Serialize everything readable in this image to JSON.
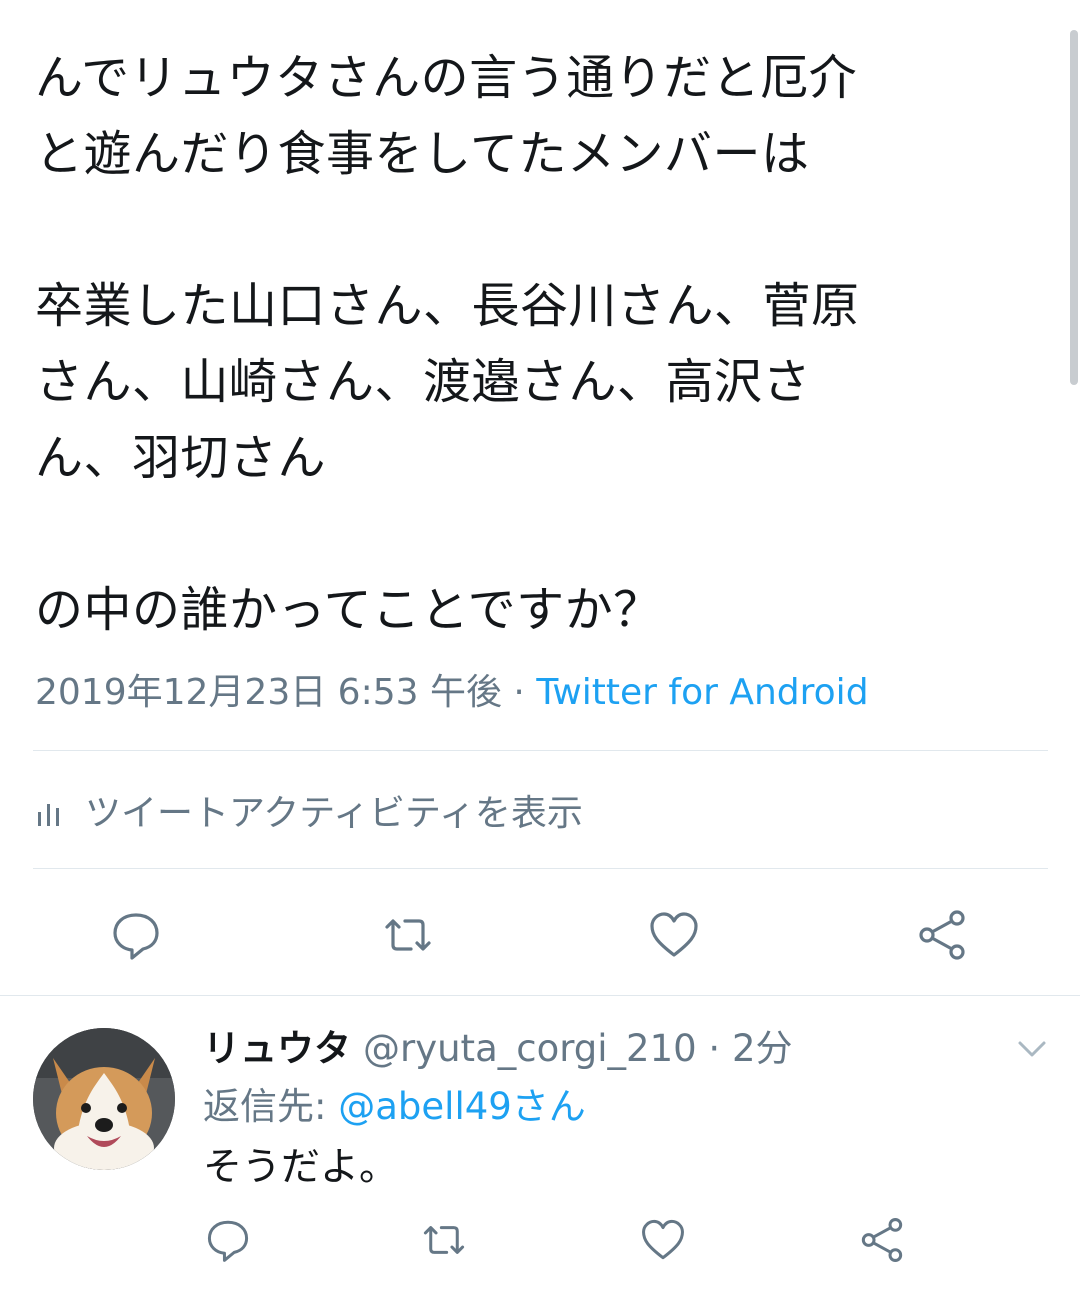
{
  "tweet": {
    "text": "んでリュウタさんの言う通りだと厄介\nと遊んだり食事をしてたメンバーは\n\n卒業した山口さん、長谷川さん、菅原\nさん、山崎さん、渡邉さん、高沢さ\nん、羽切さん\n\nの中の誰かってことですか？",
    "timestamp": "2019年12月23日 6:53 午後",
    "separator": " · ",
    "source": "Twitter for Android",
    "activity_label": "ツイートアクティビティを表示"
  },
  "actions": {
    "reply_icon": "reply-bubble-icon",
    "retweet_icon": "retweet-icon",
    "like_icon": "heart-icon",
    "share_icon": "share-icon"
  },
  "reply": {
    "display_name": "リュウタ",
    "handle": "@ryuta_corgi_210",
    "time": " · 2分",
    "reply_to_label": "返信先: ",
    "reply_to_mention": "@abell49さん",
    "text": "そうだよ。"
  },
  "colors": {
    "link": "#1da1f2",
    "secondary_text": "#657786",
    "primary_text": "#14171a",
    "divider": "#e1e8ed"
  }
}
